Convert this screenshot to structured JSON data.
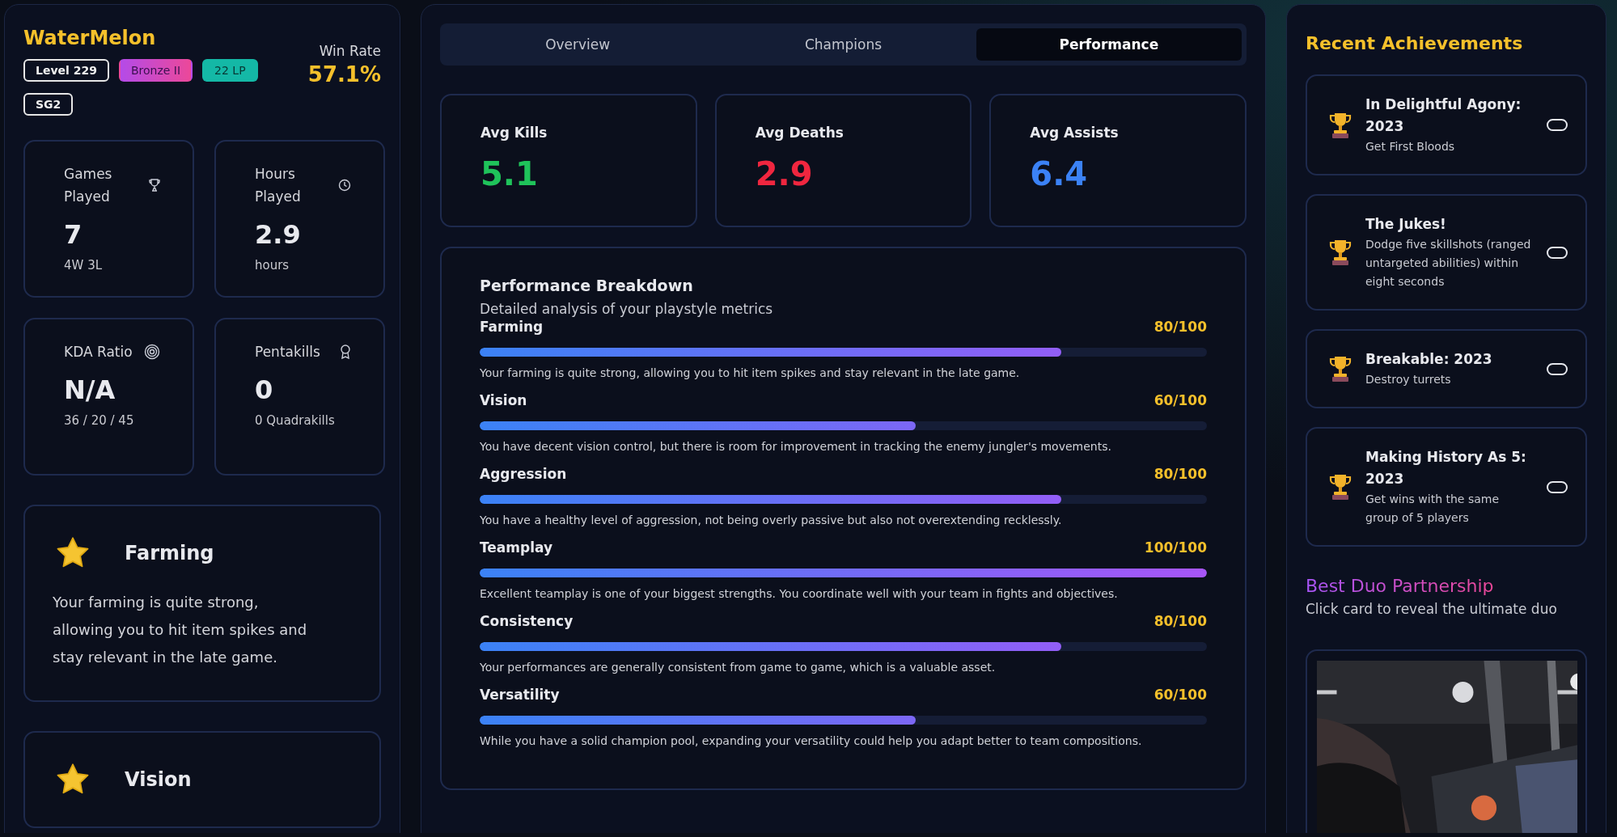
{
  "profile": {
    "name": "WaterMelon",
    "badges": [
      {
        "label": "Level 229",
        "kind": "outline"
      },
      {
        "label": "Bronze II",
        "kind": "rank"
      },
      {
        "label": "22 LP",
        "kind": "lp"
      },
      {
        "label": "SG2",
        "kind": "outline"
      }
    ],
    "win_rate": {
      "label": "Win Rate",
      "value": "57.1%"
    }
  },
  "stats": [
    {
      "label": "Games Played",
      "kind": "games",
      "value": "7",
      "sub": "4W 3L"
    },
    {
      "label": "Hours Played",
      "kind": "hours",
      "value": "2.9",
      "sub": "hours"
    },
    {
      "label": "KDA Ratio",
      "kind": "kda",
      "value": "N/A",
      "sub": "36 / 20 / 45"
    },
    {
      "label": "Pentakills",
      "kind": "pentakills",
      "value": "0",
      "sub": "0 Quadrakills"
    }
  ],
  "strengths": [
    {
      "title": "Farming",
      "text": "Your farming is quite strong, allowing you to hit item spikes and stay relevant in the late game."
    },
    {
      "title": "Vision"
    }
  ],
  "tabs": [
    {
      "label": "Overview",
      "selected": false
    },
    {
      "label": "Champions",
      "selected": false
    },
    {
      "label": "Performance",
      "selected": true
    }
  ],
  "averages": [
    {
      "label": "Avg Kills",
      "value": "5.1",
      "color": "#1fc35a"
    },
    {
      "label": "Avg Deaths",
      "value": "2.9",
      "color": "#f0263f"
    },
    {
      "label": "Avg Assists",
      "value": "6.4",
      "color": "#3b82f6"
    }
  ],
  "breakdown": {
    "title": "Performance Breakdown",
    "subtitle": "Detailed analysis of your playstyle metrics",
    "metrics": [
      {
        "name": "Farming",
        "score": "80/100",
        "level": 0.8,
        "text": "Your farming is quite strong, allowing you to hit item spikes and stay relevant in the late game."
      },
      {
        "name": "Vision",
        "score": "60/100",
        "level": 0.6,
        "text": "You have decent vision control, but there is room for improvement in tracking the enemy jungler's movements."
      },
      {
        "name": "Aggression",
        "score": "80/100",
        "level": 0.8,
        "text": "You have a healthy level of aggression, not being overly passive but also not overextending recklessly."
      },
      {
        "name": "Teamplay",
        "score": "100/100",
        "level": 1,
        "text": "Excellent teamplay is one of your biggest strengths. You coordinate well with your team in fights and objectives."
      },
      {
        "name": "Consistency",
        "score": "80/100",
        "level": 0.8,
        "text": "Your performances are generally consistent from game to game, which is a valuable asset."
      },
      {
        "name": "Versatility",
        "score": "60/100",
        "level": 0.6,
        "text": "While you have a solid champion pool, expanding your versatility could help you adapt better to team compositions."
      }
    ]
  },
  "achievements": {
    "title": "Recent Achievements",
    "items": [
      {
        "title": "In Delightful Agony: 2023",
        "text": "Get First Bloods"
      },
      {
        "title": "The Jukes!",
        "text": "Dodge five skillshots (ranged untargeted abilities) within eight seconds"
      },
      {
        "title": "Breakable: 2023",
        "text": "Destroy turrets"
      },
      {
        "title": "Making History As 5: 2023",
        "text": "Get wins with the same group of 5 players"
      }
    ]
  },
  "duo": {
    "title": "Best Duo Partnership",
    "subtitle": "Click card to reveal the ultimate duo"
  }
}
